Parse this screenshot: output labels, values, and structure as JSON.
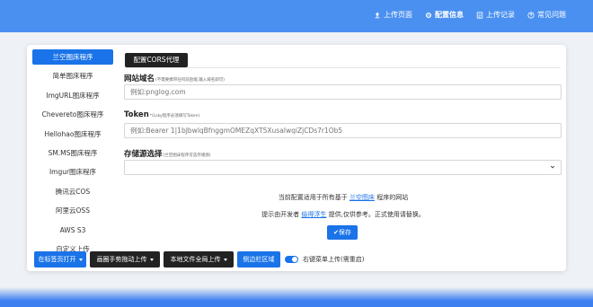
{
  "topnav": [
    {
      "label": "上传页面",
      "icon": "upload-icon",
      "active": false
    },
    {
      "label": "配置信息",
      "icon": "gear-icon",
      "active": true
    },
    {
      "label": "上传记录",
      "icon": "list-icon",
      "active": false
    },
    {
      "label": "常见问题",
      "icon": "help-icon",
      "active": false
    }
  ],
  "sidebar": {
    "items": [
      {
        "label": "兰空图床程序",
        "active": true
      },
      {
        "label": "简单图床程序",
        "active": false
      },
      {
        "label": "ImgURL图床程序",
        "active": false
      },
      {
        "label": "Chevereto图床程序",
        "active": false
      },
      {
        "label": "Hellohao图床程序",
        "active": false
      },
      {
        "label": "SM.MS图床程序",
        "active": false
      },
      {
        "label": "Imgur图床程序",
        "active": false
      },
      {
        "label": "腾讯云COS",
        "active": false
      },
      {
        "label": "阿里云OSS",
        "active": false
      },
      {
        "label": "AWS S3",
        "active": false
      },
      {
        "label": "自定义上传",
        "active": false
      }
    ]
  },
  "tab": {
    "label": "配置CORS代理"
  },
  "form": {
    "site_label": "网站域名",
    "site_hint": "(不需要携带任何前后缀,输入域名即可)",
    "site_placeholder": "例如:pnglog.com",
    "token_label": "Token",
    "token_hint": "*(Lsky程序必须填写Token)",
    "token_placeholder": "例如:Bearer 1|1bJbwlqBfnggmOMEZqXT5XusaIwqiZjCDs7r1Ob5",
    "storage_label": "存储源选择",
    "storage_hint": "(兰空图床程序可选存储源)",
    "storage_value": ""
  },
  "info": {
    "line1_prefix": "当前配置适用于所有基于",
    "line1_link": "兰空图床",
    "line1_suffix": "程序的网站",
    "line2_prefix": "提示由开发者",
    "line2_link": "偷得浮生",
    "line2_suffix": "提供,仅供参考。正式使用请替换。"
  },
  "save_label": "✔保存",
  "bottom": {
    "btn1": "在标签页打开",
    "btn2": "画圈手势拖动上传",
    "btn3": "本地文件全局上传",
    "btn4": "侧边栏区域",
    "toggle_label": "右键菜单上传(需重启)"
  },
  "colors": {
    "accent": "#1a73e8",
    "dark": "#222222",
    "header": "#4a90f0"
  }
}
